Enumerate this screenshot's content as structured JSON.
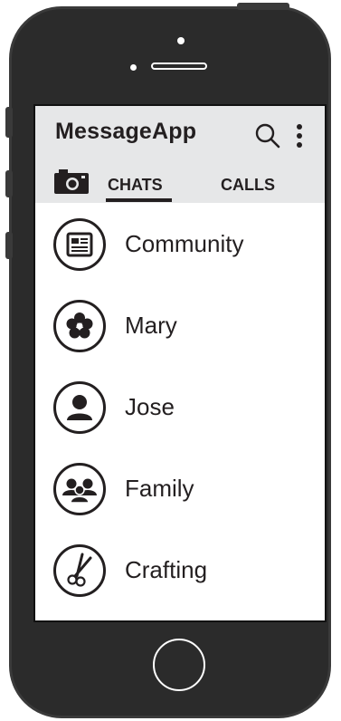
{
  "app": {
    "title": "MessageApp"
  },
  "toolbar": {
    "search_icon": "search-icon",
    "more_icon": "more-vertical-icon"
  },
  "tabs": {
    "camera_icon": "camera-icon",
    "items": [
      {
        "label": "CHATS",
        "selected": true
      },
      {
        "label": "CALLS",
        "selected": false
      }
    ]
  },
  "chats": [
    {
      "name": "Community",
      "icon": "newspaper-icon"
    },
    {
      "name": "Mary",
      "icon": "flower-icon"
    },
    {
      "name": "Jose",
      "icon": "person-icon"
    },
    {
      "name": "Family",
      "icon": "group-icon"
    },
    {
      "name": "Crafting",
      "icon": "scissors-icon"
    }
  ],
  "colors": {
    "phone_body": "#2b2b2b",
    "app_bar": "#e6e7e8",
    "text": "#231f20",
    "screen": "#ffffff"
  }
}
